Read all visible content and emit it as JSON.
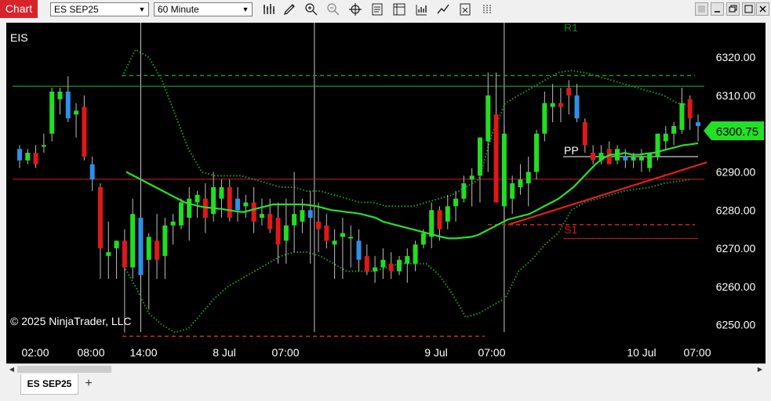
{
  "window": {
    "title": "Chart",
    "instrument": "ES SEP25",
    "interval": "60 Minute",
    "accent": "#d9232b"
  },
  "toolbar": {
    "icons": [
      "bar-type-icon",
      "drawing-tool-icon",
      "zoom-in-icon",
      "zoom-out-icon",
      "crosshair-icon",
      "properties-icon",
      "data-box-icon",
      "indicators-icon",
      "strategies-icon",
      "templates-icon",
      "overlay-icon"
    ]
  },
  "tabs": {
    "active": "ES SEP25",
    "add": "+"
  },
  "chart_data": {
    "type": "candlestick",
    "instrument_label": "EIS",
    "copyright": "© 2025 NinjaTrader, LLC",
    "x_labels": [
      "02:00",
      "08:00",
      "14:00",
      "8 Jul",
      "07:00",
      "9 Jul",
      "07:00",
      "10 Jul",
      "07:00"
    ],
    "y_ticks": [
      "6320.00",
      "6310.00",
      "6300.00",
      "6290.00",
      "6280.00",
      "6270.00",
      "6260.00",
      "6250.00"
    ],
    "ylim": [
      6244,
      6328
    ],
    "last_price": "6300.75",
    "last_price_value": 6300.75,
    "pivot_labels": {
      "r1": "R1",
      "pp": "PP",
      "s1": "S1"
    },
    "levels": {
      "green_line": 6312.4,
      "red_line": 6288.1,
      "green_dash": 6315.2,
      "red_dash_low": 6247.0,
      "red_dash_right": 6276.2,
      "pp": 6294.0,
      "s1": 6272.6
    },
    "candles": [
      [
        6296,
        6297,
        6291,
        6293
      ],
      [
        6293,
        6296,
        6292,
        6295
      ],
      [
        6295,
        6297,
        6291,
        6292
      ],
      [
        6297,
        6300,
        6295,
        6297
      ],
      [
        6300,
        6312,
        6298,
        6311
      ],
      [
        6309,
        6312,
        6305,
        6311
      ],
      [
        6311,
        6315,
        6303,
        6304
      ],
      [
        6305,
        6308,
        6299,
        6306
      ],
      [
        6307,
        6310,
        6293,
        6294
      ],
      [
        6292,
        6294,
        6285,
        6288
      ],
      [
        6286,
        6287,
        6262,
        6270
      ],
      [
        6268,
        6277,
        6262,
        6269
      ],
      [
        6270,
        6272,
        6262,
        6272
      ],
      [
        6272,
        6275,
        6248,
        6265
      ],
      [
        6265,
        6283,
        6262,
        6279
      ],
      [
        6278,
        6282,
        6261,
        6263
      ],
      [
        6267,
        6274,
        6254,
        6273
      ],
      [
        6272,
        6279,
        6262,
        6267
      ],
      [
        6268,
        6278,
        6262,
        6276
      ],
      [
        6276,
        6279,
        6271,
        6277
      ],
      [
        6276,
        6283,
        6275,
        6282
      ],
      [
        6278,
        6286,
        6272,
        6283
      ],
      [
        6282,
        6285,
        6278,
        6284
      ],
      [
        6283,
        6287,
        6274,
        6278
      ],
      [
        6279,
        6290,
        6277,
        6286
      ],
      [
        6283,
        6288,
        6278,
        6286
      ],
      [
        6286,
        6288,
        6277,
        6278
      ],
      [
        6283,
        6286,
        6277,
        6280
      ],
      [
        6281,
        6284,
        6278,
        6282
      ],
      [
        6282,
        6286,
        6274,
        6277
      ],
      [
        6278,
        6283,
        6276,
        6279
      ],
      [
        6279,
        6283,
        6274,
        6275
      ],
      [
        6278,
        6282,
        6266,
        6271
      ],
      [
        6272,
        6283,
        6266,
        6276
      ],
      [
        6276,
        6290,
        6269,
        6279
      ],
      [
        6277,
        6283,
        6274,
        6280
      ],
      [
        6280,
        6285,
        6266,
        6278
      ],
      [
        6277,
        6282,
        6269,
        6275
      ],
      [
        6276,
        6279,
        6270,
        6272
      ],
      [
        6271,
        6275,
        6262,
        6272
      ],
      [
        6273,
        6278,
        6262,
        6274
      ],
      [
        6273,
        6276,
        6265,
        6273
      ],
      [
        6272,
        6275,
        6264,
        6267
      ],
      [
        6268,
        6271,
        6263,
        6264
      ],
      [
        6264,
        6268,
        6261,
        6265
      ],
      [
        6265,
        6270,
        6262,
        6267
      ],
      [
        6266,
        6269,
        6262,
        6264
      ],
      [
        6264,
        6268,
        6263,
        6267
      ],
      [
        6266,
        6270,
        6261,
        6268
      ],
      [
        6266,
        6272,
        6264,
        6271
      ],
      [
        6271,
        6275,
        6270,
        6274
      ],
      [
        6273,
        6282,
        6270,
        6280
      ],
      [
        6280,
        6281,
        6272,
        6275
      ],
      [
        6277,
        6284,
        6275,
        6281
      ],
      [
        6281,
        6285,
        6277,
        6283
      ],
      [
        6283,
        6289,
        6282,
        6287
      ],
      [
        6288,
        6291,
        6281,
        6289
      ],
      [
        6289,
        6299,
        6282,
        6299
      ],
      [
        6298,
        6316,
        6290,
        6310
      ],
      [
        6305,
        6316,
        6282,
        6282
      ],
      [
        6281,
        6302,
        6277,
        6300
      ],
      [
        6283,
        6289,
        6279,
        6287
      ],
      [
        6286,
        6292,
        6284,
        6288
      ],
      [
        6287,
        6294,
        6281,
        6290
      ],
      [
        6290,
        6301,
        6288,
        6300
      ],
      [
        6300,
        6311,
        6298,
        6308
      ],
      [
        6307,
        6313,
        6303,
        6308
      ],
      [
        6308,
        6312,
        6303,
        6307
      ],
      [
        6312,
        6314,
        6305,
        6310
      ],
      [
        6310,
        6313,
        6303,
        6304
      ],
      [
        6303,
        6304,
        6295,
        6297
      ],
      [
        6295,
        6297,
        6292,
        6293
      ],
      [
        6293,
        6297,
        6292,
        6295
      ],
      [
        6296,
        6298,
        6292,
        6292
      ],
      [
        6293,
        6297,
        6292,
        6296
      ],
      [
        6294,
        6296,
        6291,
        6293
      ],
      [
        6293,
        6295,
        6291,
        6294
      ],
      [
        6293,
        6296,
        6290,
        6294
      ],
      [
        6291,
        6295,
        6290,
        6295
      ],
      [
        6294,
        6300,
        6293,
        6300
      ],
      [
        6298,
        6302,
        6296,
        6300
      ],
      [
        6300,
        6303,
        6297,
        6302
      ],
      [
        6301,
        6312,
        6300,
        6308
      ],
      [
        6309,
        6310,
        6301,
        6304
      ],
      [
        6303,
        6305,
        6298,
        6302
      ]
    ],
    "series": {
      "sma": [
        6290,
        6289,
        6288,
        6287,
        6286,
        6285,
        6284,
        6283,
        6282,
        6281.5,
        6281,
        6280.7,
        6280.5,
        6280.3,
        6280,
        6279.7,
        6279.5,
        6280,
        6280.5,
        6281,
        6281.5,
        6281.5,
        6281.5,
        6281.5,
        6281.5,
        6281.3,
        6281,
        6280.5,
        6280,
        6279.8,
        6279.5,
        6279.3,
        6279,
        6278.5,
        6278,
        6277,
        6276.5,
        6276,
        6275.5,
        6275,
        6274.5,
        6274,
        6273.5,
        6273,
        6272.6,
        6272.6,
        6272.8,
        6273,
        6273.5,
        6274.5,
        6275.5,
        6276.5,
        6277.5,
        6278,
        6278.5,
        6279,
        6280,
        6281,
        6282,
        6283,
        6284.5,
        6286,
        6288,
        6290,
        6292,
        6293.5,
        6294.5,
        6294.5,
        6295,
        6294.5,
        6294.5,
        6294.8,
        6295,
        6295.5,
        6296,
        6296.5,
        6297,
        6297.2,
        6297.5
      ],
      "upper_band": [
        6315,
        6322,
        6320,
        6314,
        6305,
        6296,
        6290,
        6289,
        6289,
        6289,
        6288,
        6287,
        6286,
        6286,
        6285,
        6285,
        6284,
        6283,
        6282,
        6282,
        6281,
        6281,
        6281,
        6282,
        6283,
        6284,
        6286,
        6288,
        6300,
        6308,
        6310,
        6312,
        6314,
        6316,
        6316.5,
        6316,
        6315,
        6314,
        6313,
        6312,
        6311,
        6310,
        6308,
        6307.5
      ],
      "lower_band": [
        6266,
        6260,
        6253,
        6250,
        6248,
        6249,
        6253,
        6257,
        6260,
        6262,
        6264,
        6266,
        6268,
        6269,
        6269,
        6268,
        6266,
        6264,
        6264,
        6264,
        6265,
        6266,
        6266,
        6266,
        6263,
        6258,
        6252,
        6253,
        6255,
        6257,
        6264,
        6267,
        6271,
        6274,
        6280,
        6282,
        6283,
        6284,
        6285,
        6285.5,
        6286,
        6287,
        6287.5,
        6288
      ]
    },
    "trendline": {
      "from": [
        6276.2
      ],
      "to": [
        6292.5
      ]
    }
  }
}
